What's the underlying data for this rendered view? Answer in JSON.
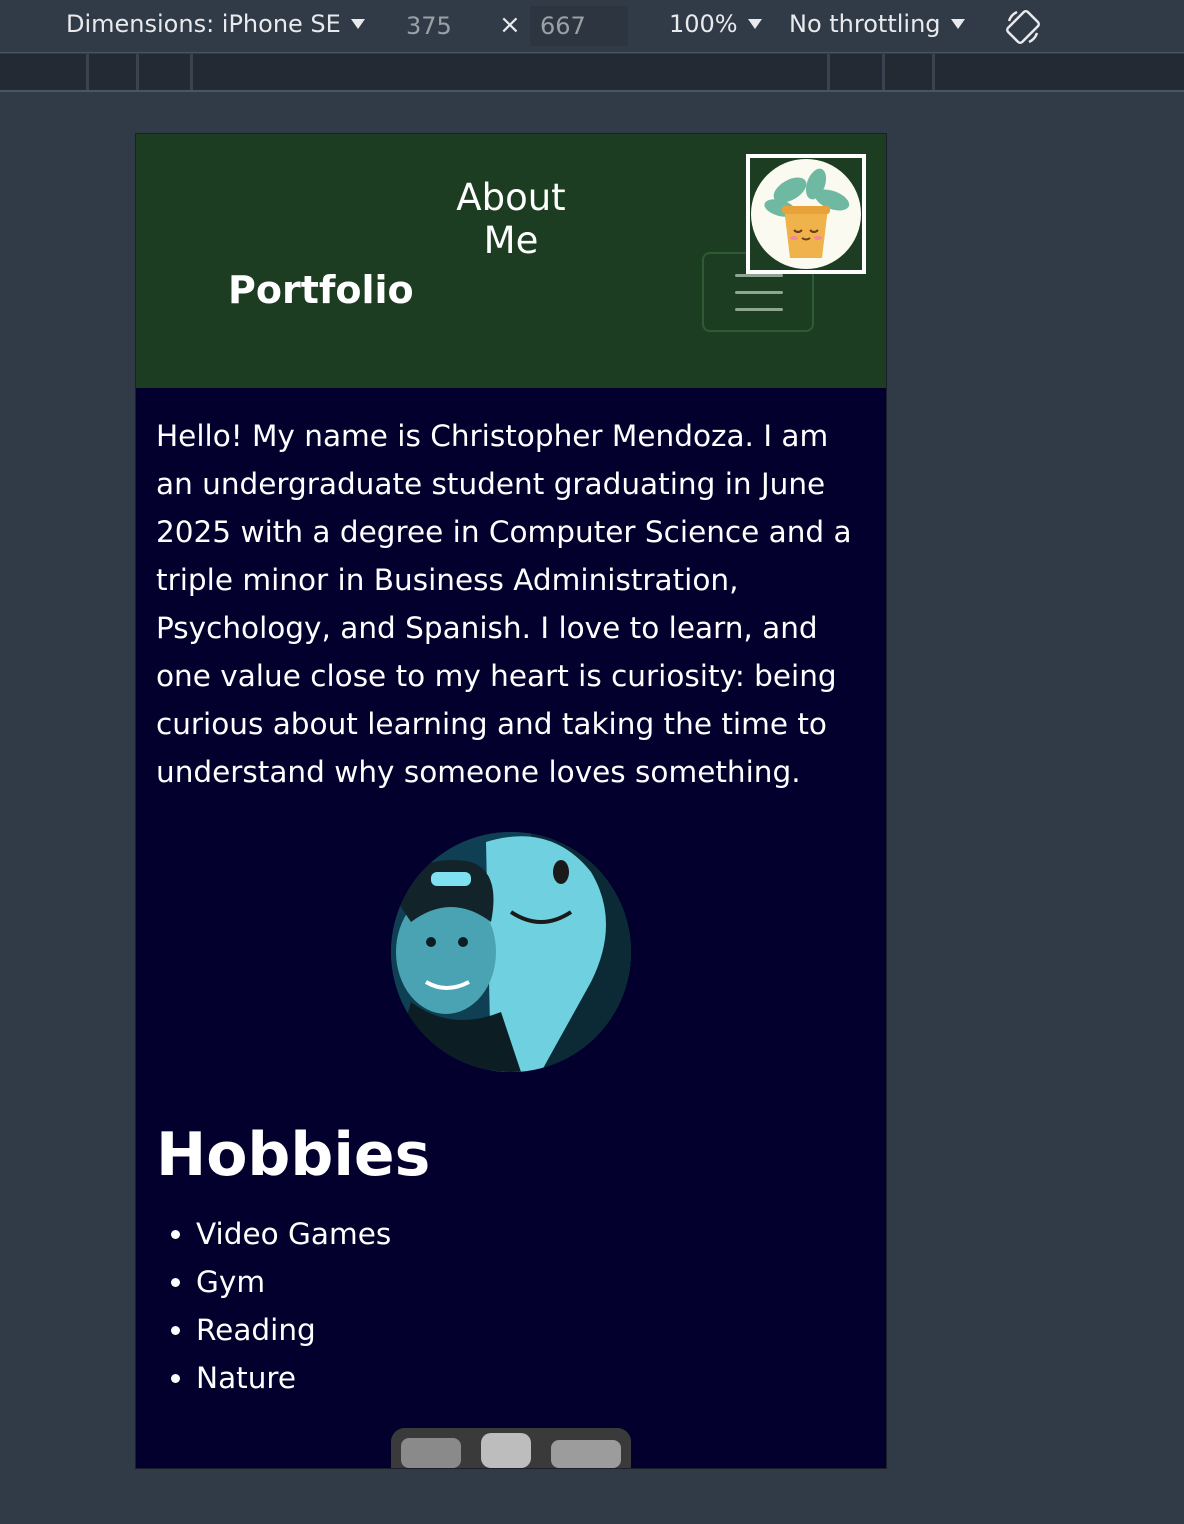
{
  "devtools": {
    "device_label": "Dimensions: iPhone SE",
    "width_value": "375",
    "height_value": "667",
    "times_symbol": "×",
    "zoom_label": "100%",
    "throttle_label": "No throttling",
    "rotate_icon": "rotate-icon"
  },
  "page": {
    "nav_link": "About Me",
    "brand": "Portfolio",
    "intro": "Hello! My name is Christopher Mendoza. I am an undergraduate student graduating in June 2025 with a degree in Computer Science and a triple minor in Business Administration, Psychology, and Spanish. I love to learn, and one value close to my heart is curiosity: being curious about learning and taking the time to understand why someone loves something.",
    "hobbies_title": "Hobbies",
    "hobbies": [
      "Video Games",
      "Gym",
      "Reading",
      "Nature"
    ]
  },
  "colors": {
    "navbar_bg": "#1d3d22",
    "page_bg": "#04002e",
    "devtools_bg": "#313b47"
  }
}
